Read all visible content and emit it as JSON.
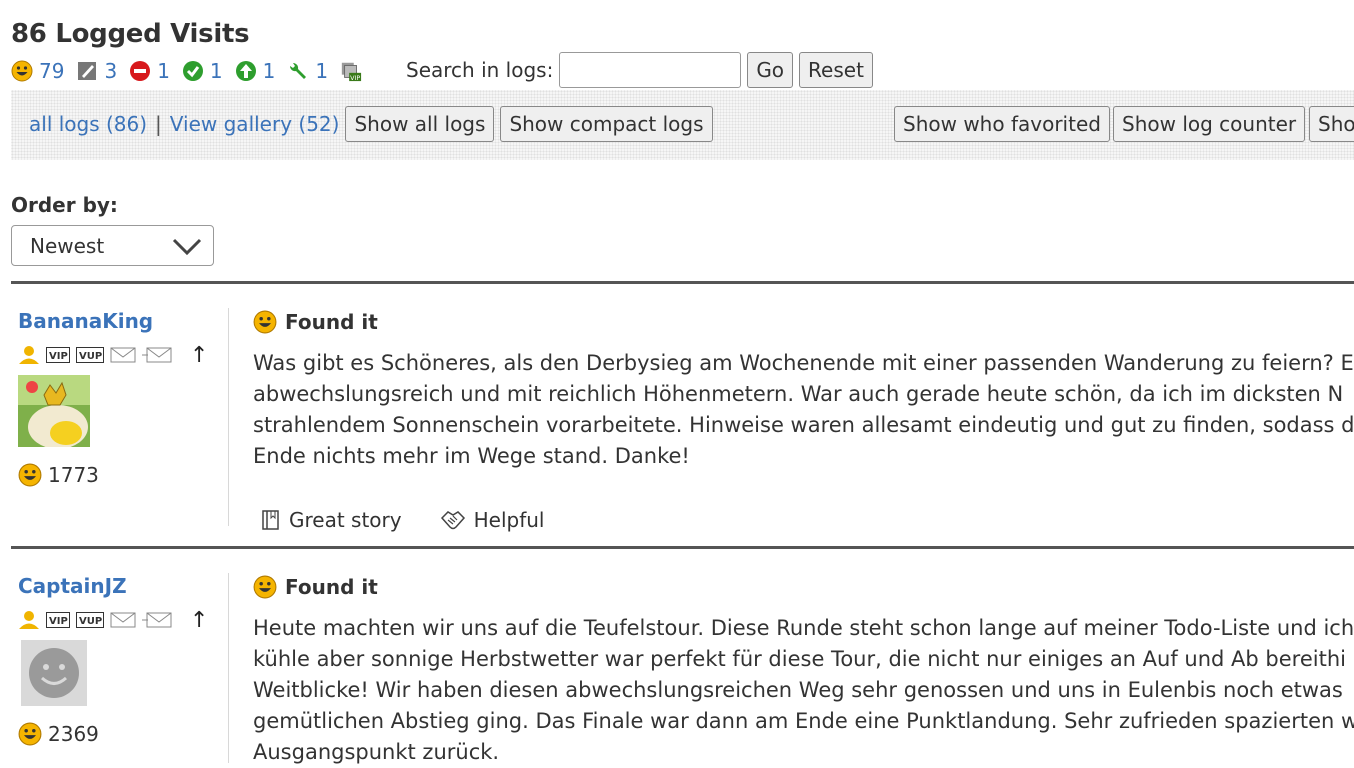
{
  "header": {
    "title": "86 Logged Visits",
    "stats": [
      {
        "icon": "found-smiley-icon",
        "count": "79"
      },
      {
        "icon": "write-note-icon",
        "count": "3"
      },
      {
        "icon": "dnf-icon",
        "count": "1"
      },
      {
        "icon": "check-icon",
        "count": "1"
      },
      {
        "icon": "publish-arrow-icon",
        "count": "1"
      },
      {
        "icon": "maintenance-wrench-icon",
        "count": "1"
      }
    ],
    "search_label": "Search in logs:",
    "search_value": "",
    "go_label": "Go",
    "reset_label": "Reset"
  },
  "filterbar": {
    "all_logs": "all logs (86)",
    "separator": "|",
    "gallery": "View gallery (52)",
    "show_all": "Show all logs",
    "show_compact": "Show compact logs",
    "show_favorited": "Show who favorited",
    "show_counter": "Show log counter",
    "show_cut": "Sho"
  },
  "order": {
    "label": "Order by:",
    "selected": "Newest"
  },
  "logs": [
    {
      "user": "BananaKing",
      "arrow": "↑",
      "count": "1773",
      "type": "Found it",
      "lines": [
        "Was gibt es Schöneres, als den Derbysieg am Wochenende mit einer passenden Wanderung zu feiern? E",
        "abwechslungsreich und mit reichlich Höhenmetern. War auch gerade heute schön, da ich im dicksten N",
        "strahlendem Sonnenschein vorarbeitete. Hinweise waren allesamt eindeutig und gut zu finden, sodass d",
        "Ende nichts mehr im Wege stand. Danke!"
      ],
      "reactions": [
        "Great story",
        "Helpful"
      ]
    },
    {
      "user": "CaptainJZ",
      "arrow": "↑",
      "count": "2369",
      "type": "Found it",
      "lines": [
        "Heute machten wir uns auf die Teufelstour. Diese Runde steht schon lange auf meiner Todo-Liste und ich",
        "kühle aber sonnige Herbstwetter war perfekt für diese Tour, die nicht nur einiges an Auf und Ab bereithi",
        "Weitblicke! Wir haben diesen abwechslungsreichen Weg sehr genossen und uns in Eulenbis noch etwas",
        "gemütlichen Abstieg ging. Das Finale war dann am Ende eine Punktlandung. Sehr zufrieden spazierten w",
        "Ausgangspunkt zurück."
      ]
    }
  ],
  "colors": {
    "link": "#3b73b9",
    "smiley": "#f5b400",
    "dnf": "#d7191c",
    "green": "#2e9e2e"
  }
}
